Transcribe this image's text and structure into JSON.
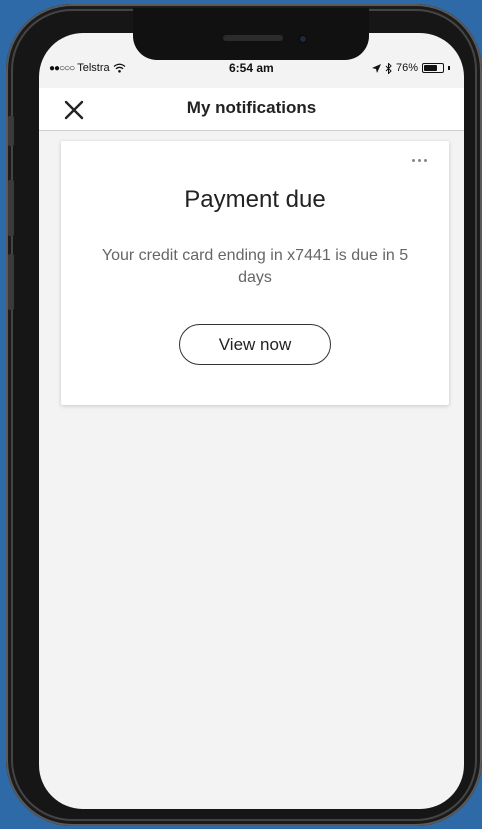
{
  "status_bar": {
    "signal_dots": "●●○○○",
    "carrier": "Telstra",
    "time": "6:54 am",
    "battery_percent": "76%",
    "battery_level": 0.76
  },
  "header": {
    "title": "My notifications",
    "close_icon": "close-icon"
  },
  "notification": {
    "title": "Payment due",
    "message": "Your credit card ending in x7441 is due in 5 days",
    "action_label": "View now",
    "more_icon": "more-horizontal-icon"
  },
  "colors": {
    "background": "#2f6aa8",
    "screen": "#f3f3f3",
    "card": "#ffffff"
  }
}
